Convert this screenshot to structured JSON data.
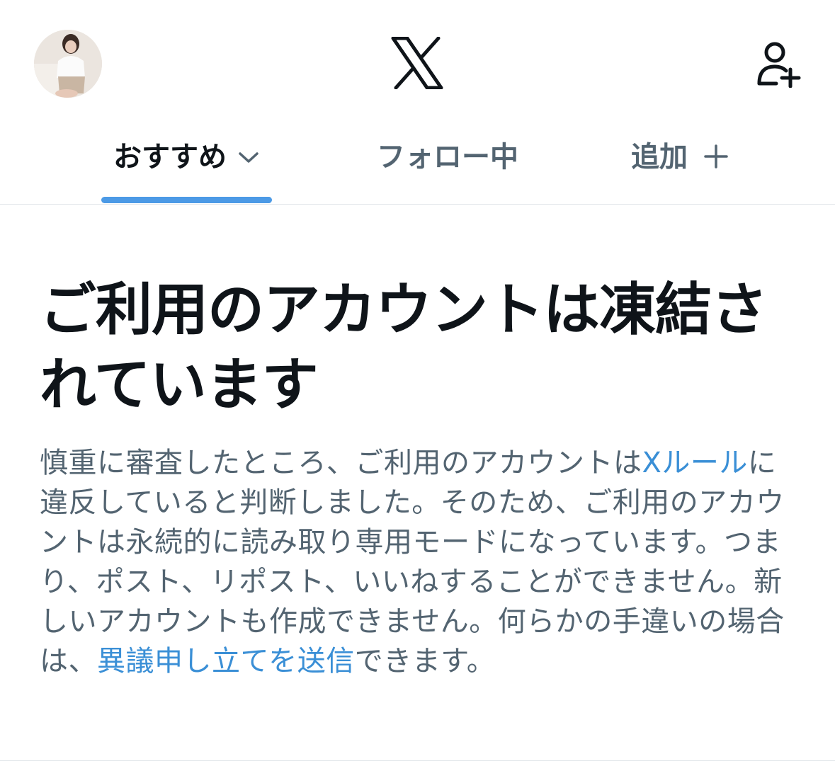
{
  "header": {
    "logo": "X",
    "avatar_icon": "user-avatar",
    "follow_icon": "add-user-icon"
  },
  "tabs": [
    {
      "label": "おすすめ",
      "active": true,
      "icon": "chevron-down-icon"
    },
    {
      "label": "フォロー中",
      "active": false
    },
    {
      "label": "追加",
      "active": false,
      "icon": "plus-icon"
    }
  ],
  "colors": {
    "text_primary": "#0f1419",
    "text_secondary": "#536471",
    "link": "#3a8fd6",
    "tab_indicator": "#4c9ae6"
  },
  "notice": {
    "title": "ご利用のアカウントは凍結されています",
    "body_part1": "慎重に審査したところ、ご利用のアカウントは",
    "rules_link": "Xルール",
    "body_part2": "に違反していると判断しました。そのため、ご利用のアカウントは永続的に読み取り専用モードになっています。つまり、ポスト、リポスト、いいねすることができません。新しいアカウントも作成できません。何らかの手違いの場合は、",
    "appeal_link": "異議申し立てを送信",
    "body_part3": "できます。"
  }
}
